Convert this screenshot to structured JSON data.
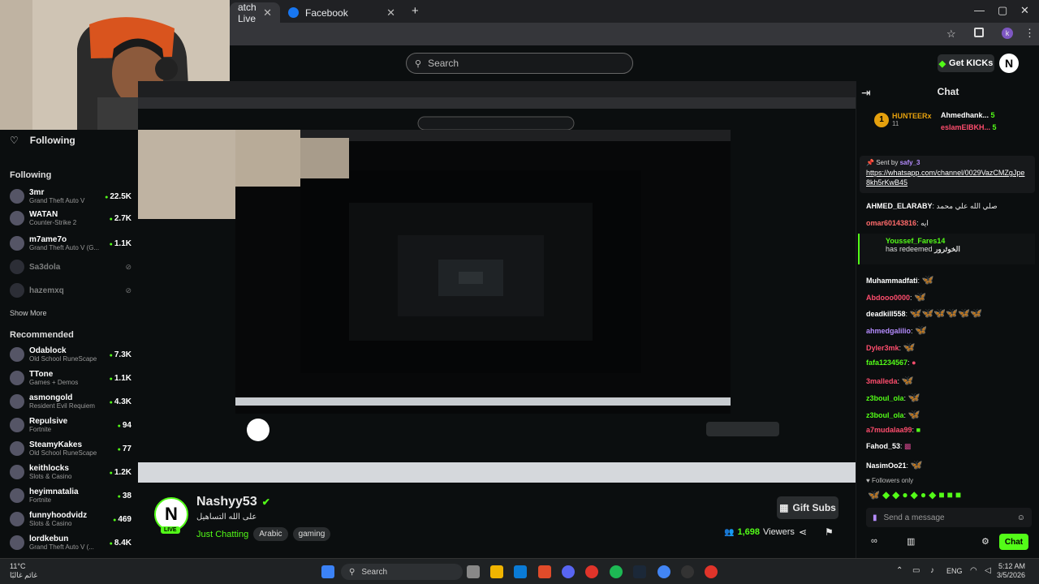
{
  "browser": {
    "tabs": [
      {
        "label": "atch Live",
        "active": true
      },
      {
        "label": "Facebook",
        "active": false
      }
    ],
    "new_tab": "+"
  },
  "header": {
    "search_placeholder": "Search",
    "get_kicks": "Get KICKs",
    "logo": "N"
  },
  "sidebar": {
    "following_title": "Following",
    "section_following": "Following",
    "following": [
      {
        "name": "3mr",
        "game": "Grand Theft Auto V",
        "viewers": "22.5K",
        "online": true
      },
      {
        "name": "WATAN",
        "game": "Counter-Strike 2",
        "viewers": "2.7K",
        "online": true
      },
      {
        "name": "m7ame7o",
        "game": "Grand Theft Auto V (G...",
        "viewers": "1.1K",
        "online": true
      },
      {
        "name": "Sa3dola",
        "game": "",
        "viewers": "",
        "online": false
      },
      {
        "name": "hazemxq",
        "game": "",
        "viewers": "",
        "online": false
      }
    ],
    "show_more": "Show More",
    "section_recommended": "Recommended",
    "recommended": [
      {
        "name": "Odablock",
        "game": "Old School RuneScape",
        "viewers": "7.3K"
      },
      {
        "name": "TTone",
        "game": "Games + Demos",
        "viewers": "1.1K"
      },
      {
        "name": "asmongold",
        "game": "Resident Evil Requiem",
        "viewers": "4.3K"
      },
      {
        "name": "Repulsive",
        "game": "Fortnite",
        "viewers": "94"
      },
      {
        "name": "SteamyKakes",
        "game": "Old School RuneScape",
        "viewers": "77"
      },
      {
        "name": "keithlocks",
        "game": "Slots & Casino",
        "viewers": "1.2K"
      },
      {
        "name": "heyimnatalia",
        "game": "Fortnite",
        "viewers": "38"
      },
      {
        "name": "funnyhoodvidz",
        "game": "Slots & Casino",
        "viewers": "469"
      },
      {
        "name": "lordkebun",
        "game": "Grand Theft Auto V (...",
        "viewers": "8.4K"
      }
    ]
  },
  "stream": {
    "streamer": "Nashyy53",
    "title": "على الله التساهيل",
    "category": "Just Chatting",
    "tags": [
      "Arabic",
      "gaming"
    ],
    "viewers": "1,698",
    "viewers_label": "Viewers",
    "gift_subs": "Gift Subs",
    "live": "LIVE"
  },
  "chat": {
    "title": "Chat",
    "top_gifters": [
      {
        "name": "HUNTEERx",
        "count": "11",
        "rank": "1"
      },
      {
        "name": "Ahmedhank...",
        "count": "5"
      },
      {
        "name": "eslamElBKH...",
        "count": "5"
      }
    ],
    "pinned": {
      "sent_by": "Sent by",
      "user": "safy_3",
      "link": "https://whatsapp.com/channel/0029VazCMZgJpe8kh5rKwB45"
    },
    "messages": [
      {
        "user": "AHMED_ELARABY",
        "text": "صلي الله علي محمد",
        "color": "#ffffff"
      },
      {
        "user": "omar60143816",
        "text": "ايه",
        "color": "#ff6b6b"
      },
      {
        "user": "Muhammadfati",
        "text": "",
        "color": "#ffffff"
      },
      {
        "user": "Abdooo0000",
        "text": "",
        "color": "#ff4d6d"
      },
      {
        "user": "deadkill558",
        "text": "",
        "color": "#ffffff"
      },
      {
        "user": "ahmedgalilio",
        "text": "",
        "color": "#b58cff"
      },
      {
        "user": "Dyler3mk",
        "text": "",
        "color": "#ff4d6d"
      },
      {
        "user": "fafa1234567",
        "text": "",
        "color": "#53fc18"
      },
      {
        "user": "3malleda",
        "text": "",
        "color": "#ff4d6d"
      },
      {
        "user": "z3boul_ola",
        "text": "",
        "color": "#53fc18"
      },
      {
        "user": "z3boul_ola",
        "text": "",
        "color": "#53fc18"
      },
      {
        "user": "a7mudalaa99",
        "text": "",
        "color": "#ff4d6d"
      },
      {
        "user": "Fahod_53",
        "text": "",
        "color": "#ffffff"
      },
      {
        "user": "NasimOo21",
        "text": "",
        "color": "#ffffff"
      }
    ],
    "redeem": {
      "user": "Youssef_Fares14",
      "text": "has redeemed",
      "reward": "الخوثرور"
    },
    "followers_only": "Followers only",
    "input_placeholder": "Send a message",
    "send_button": "Chat"
  },
  "taskbar": {
    "weather_temp": "11°C",
    "weather_text": "غائم غالبًا",
    "search": "Search",
    "lang": "ENG",
    "time": "5:12 AM",
    "date": "3/5/2026"
  },
  "colors": {
    "accent": "#53fc18",
    "bg": "#0b0e0f"
  }
}
